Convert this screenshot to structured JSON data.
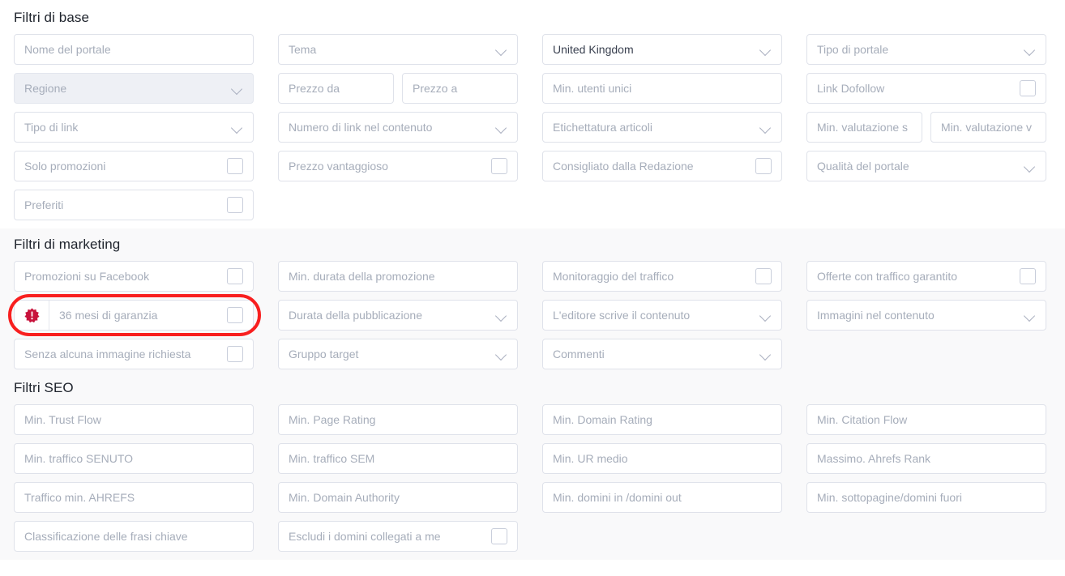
{
  "sections": [
    {
      "id": "base",
      "title": "Filtri di base",
      "fields": [
        {
          "label": "Nome del portale",
          "type": "text"
        },
        {
          "label": "Tema",
          "type": "select"
        },
        {
          "label": "United Kingdom",
          "type": "select",
          "filled": true
        },
        {
          "label": "Tipo di portale",
          "type": "select"
        },
        {
          "label": "Regione",
          "type": "select",
          "disabled": true
        },
        {
          "label": "Prezzo da",
          "label2": "Prezzo a",
          "type": "split-text"
        },
        {
          "label": "Min. utenti unici",
          "type": "text"
        },
        {
          "label": "Link Dofollow",
          "type": "checkbox"
        },
        {
          "label": "Tipo di link",
          "type": "select"
        },
        {
          "label": "Numero di link nel contenuto",
          "type": "select"
        },
        {
          "label": "Etichettatura articoli",
          "type": "select"
        },
        {
          "label": "Min. valutazione s",
          "label2": "Min. valutazione v",
          "type": "split-text"
        },
        {
          "label": "Solo promozioni",
          "type": "checkbox"
        },
        {
          "label": "Prezzo vantaggioso",
          "type": "checkbox"
        },
        {
          "label": "Consigliato dalla Redazione",
          "type": "checkbox"
        },
        {
          "label": "Qualità del portale",
          "type": "select"
        },
        {
          "label": "Preferiti",
          "type": "checkbox"
        },
        {
          "label": "",
          "type": "empty"
        },
        {
          "label": "",
          "type": "empty"
        },
        {
          "label": "",
          "type": "empty"
        }
      ]
    },
    {
      "id": "marketing",
      "title": "Filtri di marketing",
      "fields": [
        {
          "label": "Promozioni su Facebook",
          "type": "checkbox"
        },
        {
          "label": "Min. durata della promozione",
          "type": "text"
        },
        {
          "label": "Monitoraggio del traffico",
          "type": "checkbox"
        },
        {
          "label": "Offerte con traffico garantito",
          "type": "checkbox"
        },
        {
          "label": "36 mesi di garanzia",
          "type": "checkbox",
          "badge": "warning-badge-icon",
          "highlighted": true
        },
        {
          "label": "Durata della pubblicazione",
          "type": "select"
        },
        {
          "label": "L'editore scrive il contenuto",
          "type": "select"
        },
        {
          "label": "Immagini nel contenuto",
          "type": "select"
        },
        {
          "label": "Senza alcuna immagine richiesta",
          "type": "checkbox"
        },
        {
          "label": "Gruppo target",
          "type": "select"
        },
        {
          "label": "Commenti",
          "type": "select"
        },
        {
          "label": "",
          "type": "empty"
        }
      ]
    },
    {
      "id": "seo",
      "title": "Filtri SEO",
      "fields": [
        {
          "label": "Min. Trust Flow",
          "type": "text"
        },
        {
          "label": "Min. Page Rating",
          "type": "text"
        },
        {
          "label": "Min. Domain Rating",
          "type": "text"
        },
        {
          "label": "Min. Citation Flow",
          "type": "text"
        },
        {
          "label": "Min. traffico SENUTO",
          "type": "text"
        },
        {
          "label": "Min. traffico SEM",
          "type": "text"
        },
        {
          "label": "Min. UR medio",
          "type": "text"
        },
        {
          "label": "Massimo. Ahrefs Rank",
          "type": "text"
        },
        {
          "label": "Traffico min. AHREFS",
          "type": "text"
        },
        {
          "label": "Min. Domain Authority",
          "type": "text"
        },
        {
          "label": "Min. domini in /domini out",
          "type": "text"
        },
        {
          "label": "Min. sottopagine/domini fuori",
          "type": "text"
        },
        {
          "label": "Classificazione delle frasi chiave",
          "type": "text"
        },
        {
          "label": "Escludi i domini collegati a me",
          "type": "checkbox"
        },
        {
          "label": "",
          "type": "empty"
        },
        {
          "label": "",
          "type": "empty"
        }
      ]
    }
  ],
  "colors": {
    "highlight_ring": "#f81f1f",
    "badge": "#c8133c",
    "placeholder_text": "#a6adba",
    "filled_text": "#3a4150",
    "field_border": "#dfe2ea",
    "section_bg_base": "#ffffff",
    "section_bg_alt": "#f9f9fa"
  }
}
